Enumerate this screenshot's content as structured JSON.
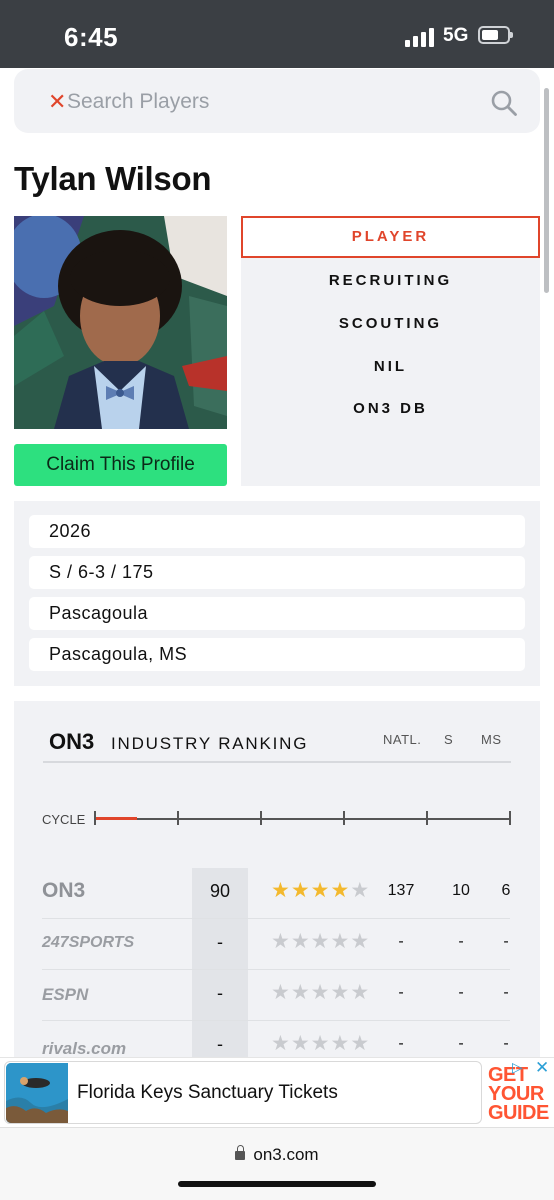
{
  "status_bar": {
    "time": "6:45",
    "network": "5G"
  },
  "search": {
    "placeholder": "Search Players"
  },
  "player": {
    "name": "Tylan Wilson"
  },
  "profile": {
    "claim_label": "Claim This Profile"
  },
  "nav": {
    "items": [
      {
        "label": "PLAYER",
        "active": true
      },
      {
        "label": "RECRUITING",
        "active": false
      },
      {
        "label": "SCOUTING",
        "active": false
      },
      {
        "label": "NIL",
        "active": false
      },
      {
        "label": "ON3 DB",
        "active": false
      }
    ]
  },
  "info": {
    "class_year": "2026",
    "position_size": "S / 6-3 / 175",
    "school": "Pascagoula",
    "hometown": "Pascagoula, MS"
  },
  "ranking": {
    "logo": "ON3",
    "title": "INDUSTRY RANKING",
    "columns": [
      "NATL.",
      "S",
      "MS"
    ],
    "cycle_label": "CYCLE",
    "cycle_progress": 0.1,
    "rows": [
      {
        "source": "ON3",
        "score": "90",
        "stars": 4,
        "natl": "137",
        "state": "10",
        "pos": "6"
      },
      {
        "source": "247SPORTS",
        "score": "-",
        "stars": 0,
        "natl": "-",
        "state": "-",
        "pos": "-"
      },
      {
        "source": "ESPN",
        "score": "-",
        "stars": 0,
        "natl": "-",
        "state": "-",
        "pos": "-"
      },
      {
        "source": "rivals.com",
        "score": "-",
        "stars": 0,
        "natl": "-",
        "state": "-",
        "pos": "-"
      }
    ]
  },
  "ad": {
    "text": "Florida Keys Sanctuary Tickets",
    "brand_line1": "GET",
    "brand_line2": "YOUR",
    "brand_line3": "GUIDE"
  },
  "browser": {
    "url": "on3.com"
  },
  "colors": {
    "accent": "#e0452b",
    "claim": "#2de07f",
    "star": "#f3b92e"
  }
}
